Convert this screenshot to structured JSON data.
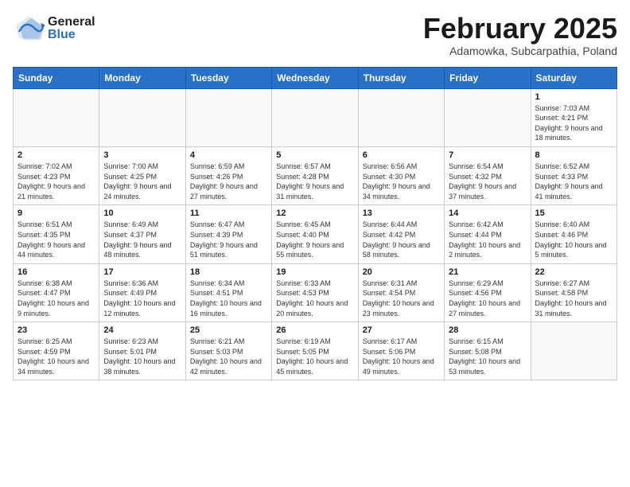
{
  "header": {
    "logo_general": "General",
    "logo_blue": "Blue",
    "month_title": "February 2025",
    "location": "Adamowka, Subcarpathia, Poland"
  },
  "weekdays": [
    "Sunday",
    "Monday",
    "Tuesday",
    "Wednesday",
    "Thursday",
    "Friday",
    "Saturday"
  ],
  "weeks": [
    [
      {
        "day": "",
        "info": ""
      },
      {
        "day": "",
        "info": ""
      },
      {
        "day": "",
        "info": ""
      },
      {
        "day": "",
        "info": ""
      },
      {
        "day": "",
        "info": ""
      },
      {
        "day": "",
        "info": ""
      },
      {
        "day": "1",
        "info": "Sunrise: 7:03 AM\nSunset: 4:21 PM\nDaylight: 9 hours and 18 minutes."
      }
    ],
    [
      {
        "day": "2",
        "info": "Sunrise: 7:02 AM\nSunset: 4:23 PM\nDaylight: 9 hours and 21 minutes."
      },
      {
        "day": "3",
        "info": "Sunrise: 7:00 AM\nSunset: 4:25 PM\nDaylight: 9 hours and 24 minutes."
      },
      {
        "day": "4",
        "info": "Sunrise: 6:59 AM\nSunset: 4:26 PM\nDaylight: 9 hours and 27 minutes."
      },
      {
        "day": "5",
        "info": "Sunrise: 6:57 AM\nSunset: 4:28 PM\nDaylight: 9 hours and 31 minutes."
      },
      {
        "day": "6",
        "info": "Sunrise: 6:56 AM\nSunset: 4:30 PM\nDaylight: 9 hours and 34 minutes."
      },
      {
        "day": "7",
        "info": "Sunrise: 6:54 AM\nSunset: 4:32 PM\nDaylight: 9 hours and 37 minutes."
      },
      {
        "day": "8",
        "info": "Sunrise: 6:52 AM\nSunset: 4:33 PM\nDaylight: 9 hours and 41 minutes."
      }
    ],
    [
      {
        "day": "9",
        "info": "Sunrise: 6:51 AM\nSunset: 4:35 PM\nDaylight: 9 hours and 44 minutes."
      },
      {
        "day": "10",
        "info": "Sunrise: 6:49 AM\nSunset: 4:37 PM\nDaylight: 9 hours and 48 minutes."
      },
      {
        "day": "11",
        "info": "Sunrise: 6:47 AM\nSunset: 4:39 PM\nDaylight: 9 hours and 51 minutes."
      },
      {
        "day": "12",
        "info": "Sunrise: 6:45 AM\nSunset: 4:40 PM\nDaylight: 9 hours and 55 minutes."
      },
      {
        "day": "13",
        "info": "Sunrise: 6:44 AM\nSunset: 4:42 PM\nDaylight: 9 hours and 58 minutes."
      },
      {
        "day": "14",
        "info": "Sunrise: 6:42 AM\nSunset: 4:44 PM\nDaylight: 10 hours and 2 minutes."
      },
      {
        "day": "15",
        "info": "Sunrise: 6:40 AM\nSunset: 4:46 PM\nDaylight: 10 hours and 5 minutes."
      }
    ],
    [
      {
        "day": "16",
        "info": "Sunrise: 6:38 AM\nSunset: 4:47 PM\nDaylight: 10 hours and 9 minutes."
      },
      {
        "day": "17",
        "info": "Sunrise: 6:36 AM\nSunset: 4:49 PM\nDaylight: 10 hours and 12 minutes."
      },
      {
        "day": "18",
        "info": "Sunrise: 6:34 AM\nSunset: 4:51 PM\nDaylight: 10 hours and 16 minutes."
      },
      {
        "day": "19",
        "info": "Sunrise: 6:33 AM\nSunset: 4:53 PM\nDaylight: 10 hours and 20 minutes."
      },
      {
        "day": "20",
        "info": "Sunrise: 6:31 AM\nSunset: 4:54 PM\nDaylight: 10 hours and 23 minutes."
      },
      {
        "day": "21",
        "info": "Sunrise: 6:29 AM\nSunset: 4:56 PM\nDaylight: 10 hours and 27 minutes."
      },
      {
        "day": "22",
        "info": "Sunrise: 6:27 AM\nSunset: 4:58 PM\nDaylight: 10 hours and 31 minutes."
      }
    ],
    [
      {
        "day": "23",
        "info": "Sunrise: 6:25 AM\nSunset: 4:59 PM\nDaylight: 10 hours and 34 minutes."
      },
      {
        "day": "24",
        "info": "Sunrise: 6:23 AM\nSunset: 5:01 PM\nDaylight: 10 hours and 38 minutes."
      },
      {
        "day": "25",
        "info": "Sunrise: 6:21 AM\nSunset: 5:03 PM\nDaylight: 10 hours and 42 minutes."
      },
      {
        "day": "26",
        "info": "Sunrise: 6:19 AM\nSunset: 5:05 PM\nDaylight: 10 hours and 45 minutes."
      },
      {
        "day": "27",
        "info": "Sunrise: 6:17 AM\nSunset: 5:06 PM\nDaylight: 10 hours and 49 minutes."
      },
      {
        "day": "28",
        "info": "Sunrise: 6:15 AM\nSunset: 5:08 PM\nDaylight: 10 hours and 53 minutes."
      },
      {
        "day": "",
        "info": ""
      }
    ]
  ]
}
